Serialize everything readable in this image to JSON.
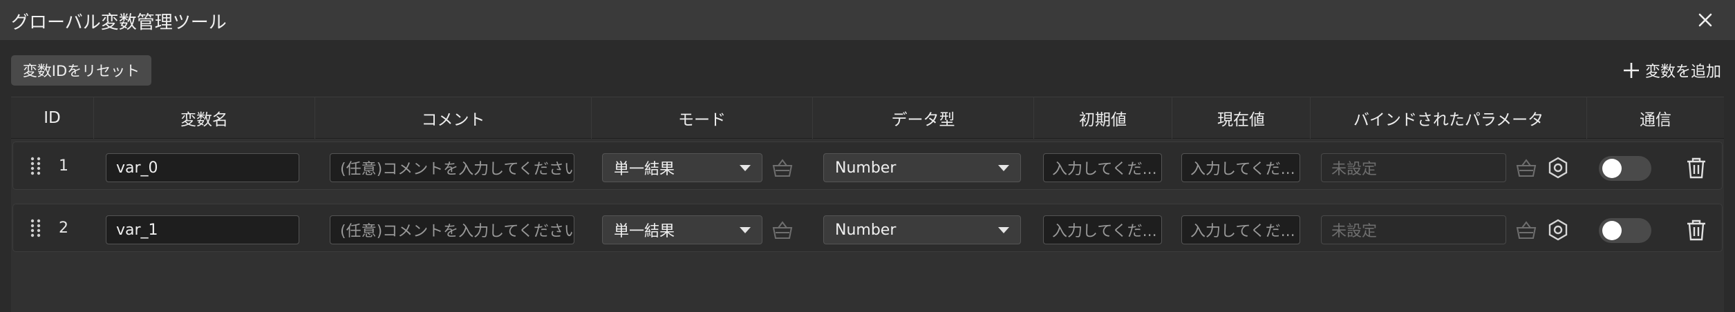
{
  "window": {
    "title": "グローバル変数管理ツール"
  },
  "toolbar": {
    "reset_label": "変数IDをリセット",
    "add_label": "変数を追加"
  },
  "columns": [
    "ID",
    "変数名",
    "コメント",
    "モード",
    "データ型",
    "初期値",
    "現在値",
    "バインドされたパラメータ",
    "通信"
  ],
  "rows": [
    {
      "id": "1",
      "name": "var_0",
      "comment_placeholder": "(任意)コメントを入力してください",
      "mode": "単一結果",
      "data_type": "Number",
      "initial_placeholder": "入力してくだ...",
      "current_placeholder": "入力してくだ...",
      "bound_param": "未設定",
      "comm_on": false
    },
    {
      "id": "2",
      "name": "var_1",
      "comment_placeholder": "(任意)コメントを入力してください",
      "mode": "単一結果",
      "data_type": "Number",
      "initial_placeholder": "入力してくだ...",
      "current_placeholder": "入力してくだ...",
      "bound_param": "未設定",
      "comm_on": false
    }
  ],
  "icons": {
    "close": "close-icon",
    "add": "plus-icon",
    "drag": "drag-handle-icon",
    "basket": "basket-icon",
    "settings": "hexagon-settings-icon",
    "delete": "trash-icon"
  }
}
